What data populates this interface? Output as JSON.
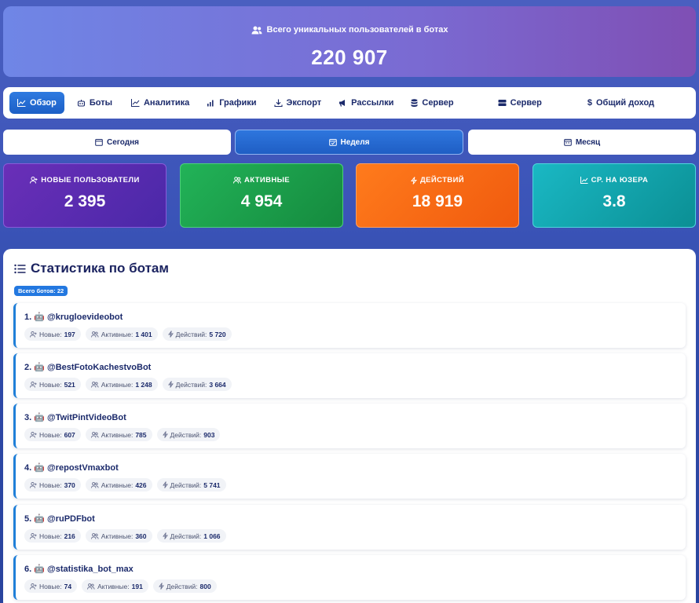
{
  "hero": {
    "icon": "users-icon",
    "label": "Всего уникальных пользователей в ботах",
    "value": "220 907"
  },
  "nav": {
    "items": [
      {
        "icon": "chart-line-icon",
        "label": "Обзор",
        "active": true
      },
      {
        "icon": "robot-icon",
        "label": "Боты"
      },
      {
        "icon": "trend-icon",
        "label": "Аналитика"
      },
      {
        "icon": "bar-chart-icon",
        "label": "Графики"
      },
      {
        "icon": "download-icon",
        "label": "Экспорт"
      },
      {
        "icon": "megaphone-icon",
        "label": "Рассылки"
      },
      {
        "icon": "database-icon",
        "label": "Сервер"
      },
      {
        "icon": "server-icon",
        "label": "Сервер"
      },
      {
        "icon": "dollar-icon",
        "label": "Общий доход"
      }
    ]
  },
  "periods": [
    {
      "icon": "calendar-icon",
      "label": "Сегодня"
    },
    {
      "icon": "calendar-week-icon",
      "label": "Неделя",
      "active": true
    },
    {
      "icon": "calendar-month-icon",
      "label": "Месяц"
    }
  ],
  "cards": [
    {
      "icon": "user-plus-icon",
      "label": "НОВЫЕ ПОЛЬЗОВАТЕЛИ",
      "value": "2 395",
      "color": "#5a2db0"
    },
    {
      "icon": "users-icon",
      "label": "АКТИВНЫЕ",
      "value": "4 954",
      "color": "#1d9e4c"
    },
    {
      "icon": "bolt-icon",
      "label": "ДЕЙСТВИЙ",
      "value": "18 919",
      "color": "#f56a14"
    },
    {
      "icon": "trend-icon",
      "label": "СР. НА ЮЗЕРА",
      "value": "3.8",
      "color": "#13a3ac"
    }
  ],
  "stats": {
    "title": "Статистика по ботам",
    "badge": "Всего ботов: 22",
    "labels": {
      "new": "Новые:",
      "active": "Активные:",
      "actions": "Действий:"
    },
    "bots": [
      {
        "name": "1. 🤖 @krugloevideobot",
        "new": "197",
        "active": "1 401",
        "actions": "5 720"
      },
      {
        "name": "2. 🤖 @BestFotoKachestvoBot",
        "new": "521",
        "active": "1 248",
        "actions": "3 664"
      },
      {
        "name": "3. 🤖 @TwitPintVideoBot",
        "new": "607",
        "active": "785",
        "actions": "903"
      },
      {
        "name": "4. 🤖 @repostVmaxbot",
        "new": "370",
        "active": "426",
        "actions": "5 741"
      },
      {
        "name": "5. 🤖 @ruPDFbot",
        "new": "216",
        "active": "360",
        "actions": "1 066"
      },
      {
        "name": "6. 🤖 @statistika_bot_max",
        "new": "74",
        "active": "191",
        "actions": "800"
      }
    ]
  }
}
